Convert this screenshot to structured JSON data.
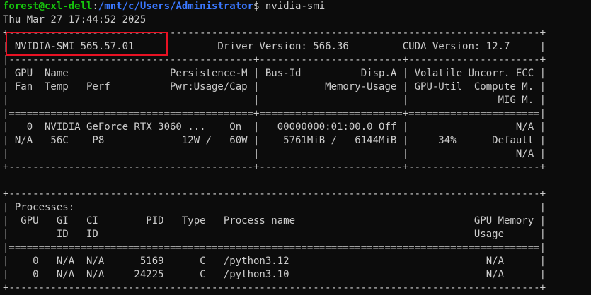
{
  "prompt": {
    "user_host": "forest@cxl-dell",
    "separator": ":",
    "path": "/mnt/c/Users/Administrator",
    "symbol": "$ ",
    "command": "nvidia-smi"
  },
  "timestamp": "Thu Mar 27 17:44:52 2025",
  "smi_table": {
    "border_top": "+-----------------------------------------------------------------------------------------+",
    "version_row": "| NVIDIA-SMI 565.57.01              Driver Version: 566.36         CUDA Version: 12.7     |",
    "separator": "|-----------------------------------------+------------------------+----------------------+",
    "header_row_1": "| GPU  Name                 Persistence-M | Bus-Id          Disp.A | Volatile Uncorr. ECC |",
    "header_row_2": "| Fan  Temp   Perf          Pwr:Usage/Cap |           Memory-Usage | GPU-Util  Compute M. |",
    "header_row_3": "|                                         |                        |               MIG M. |",
    "double_separator": "|=========================================+========================+======================|",
    "gpu_row_1": "|   0  NVIDIA GeForce RTX 3060 ...    On  |   00000000:01:00.0 Off |                  N/A |",
    "gpu_row_2": "| N/A   56C    P8             12W /   60W |    5761MiB /   6144MiB |     34%      Default |",
    "gpu_row_3": "|                                         |                        |                  N/A |",
    "border_bottom": "+-----------------------------------------+------------------------+----------------------+",
    "blank": "",
    "proc_border_top": "+-----------------------------------------------------------------------------------------+",
    "proc_title": "| Processes:                                                                              |",
    "proc_header_1": "|  GPU   GI   CI        PID   Type   Process name                              GPU Memory |",
    "proc_header_2": "|        ID   ID                                                               Usage      |",
    "proc_double_separator": "|=========================================================================================|",
    "proc_row_1": "|    0   N/A  N/A      5169      C   /python3.12                                 N/A      |",
    "proc_row_2": "|    0   N/A  N/A     24225      C   /python3.10                                 N/A      |",
    "proc_border_bottom": "+-----------------------------------------------------------------------------------------+"
  },
  "highlight_color": "#e81123"
}
